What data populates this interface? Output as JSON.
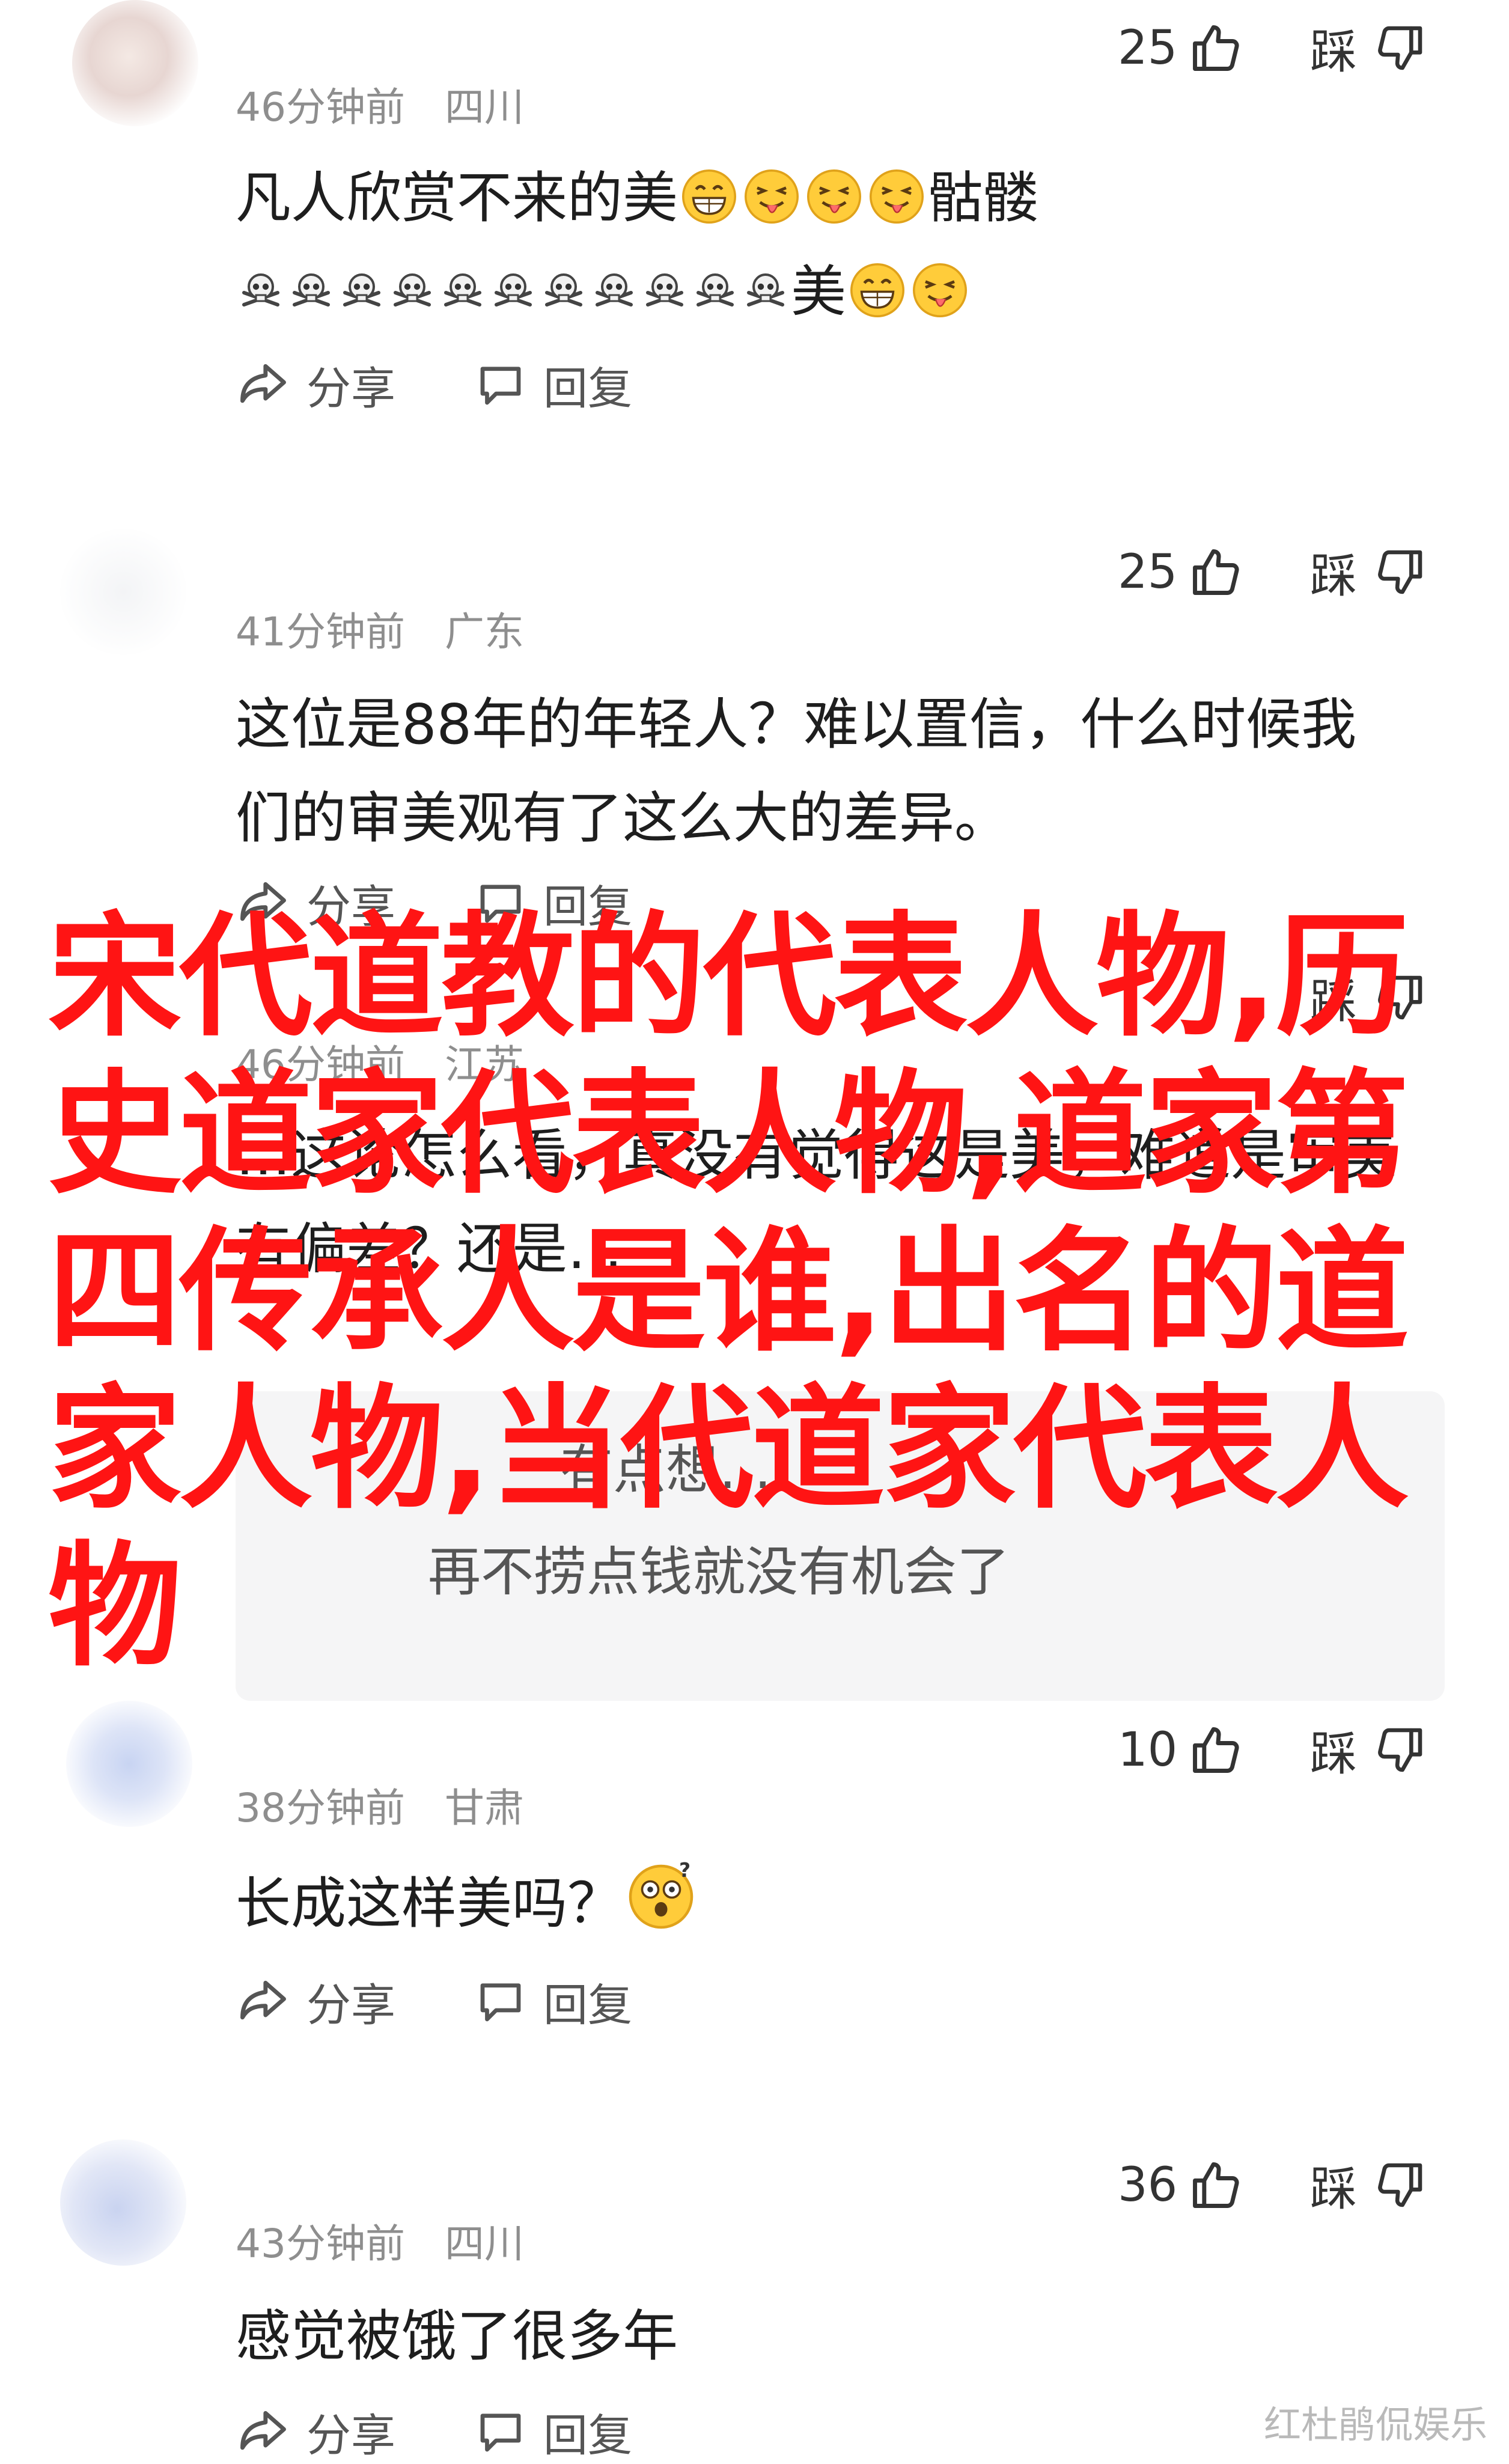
{
  "comments": [
    {
      "username": "",
      "time": "46分钟前",
      "location": "四川",
      "likes": "25",
      "dislike_label": "踩",
      "text_line1": "凡人欣赏不来的美",
      "text_line1_tail": "骷髅",
      "text_line2_tail": "美",
      "share_label": "分享",
      "reply_label": "回复"
    },
    {
      "username": "",
      "time": "41分钟前",
      "location": "广东",
      "likes": "25",
      "dislike_label": "踩",
      "text_line1": "这位是88年的年轻人？难以置信，什么时候我",
      "text_line2": "们的审美观有了这么大的差异。",
      "share_label": "分享",
      "reply_label": "回复"
    },
    {
      "username": "",
      "time": "46分钟前",
      "location": "江苏",
      "likes": "",
      "dislike_label": "踩",
      "text_line1": "…这论怎么看，真没有觉得这是美，难道是审美",
      "text_line2": "有偏差？还是…",
      "replies": [
        "有点想…",
        "再不捞点钱就没有机会了"
      ]
    },
    {
      "username": "",
      "time": "38分钟前",
      "location": "甘肃",
      "likes": "10",
      "dislike_label": "踩",
      "text_line1": "长成这样美吗？",
      "share_label": "分享",
      "reply_label": "回复"
    },
    {
      "username": "",
      "time": "43分钟前",
      "location": "四川",
      "likes": "36",
      "dislike_label": "踩",
      "text_line1": "感觉被饿了很多年",
      "share_label": "分享",
      "reply_label": "回复"
    }
  ],
  "overlay_title": "宋代道教的代表人物,历史道家代表人物,道家第四传承人是谁,出名的道家人物,当代道家代表人物",
  "watermark": "红杜鹃侃娱乐",
  "colors": {
    "overlay_red": "#ff1414",
    "meta_gray": "#8e8e8e",
    "reply_bg": "#f5f5f6"
  },
  "icons": [
    "thumbs-up-icon",
    "thumbs-down-icon",
    "share-icon",
    "reply-icon",
    "grin-emoji-icon",
    "wink-tongue-emoji-icon",
    "skull-crossbones-icon",
    "shocked-emoji-icon"
  ]
}
